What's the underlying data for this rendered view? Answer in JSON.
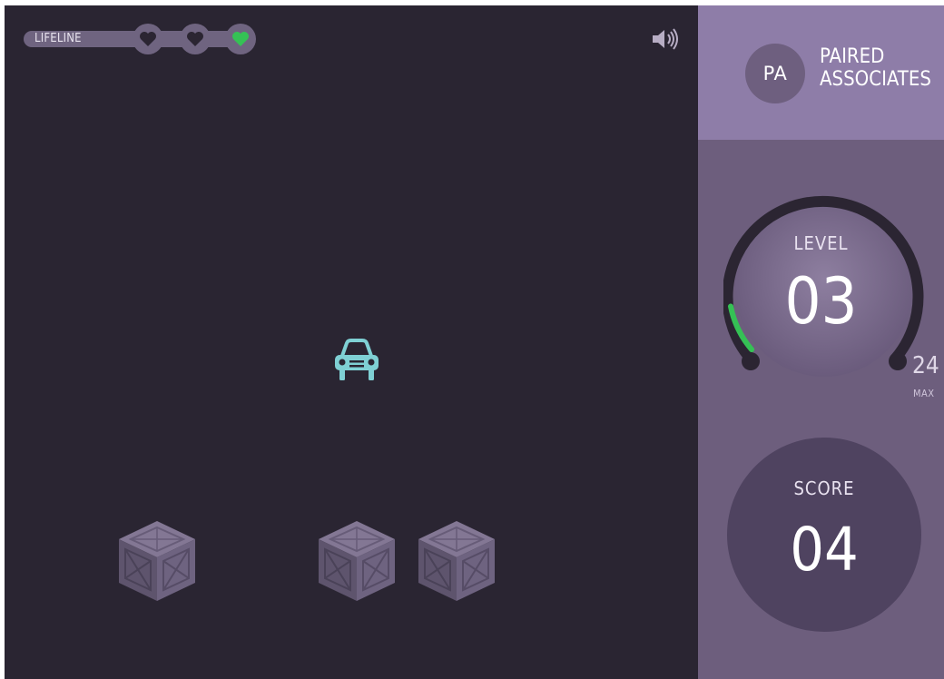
{
  "lifeline": {
    "label": "LIFELINE",
    "hearts_total": 3,
    "hearts_active": 1,
    "colors": {
      "empty": "#2b2532",
      "active": "#35c155"
    }
  },
  "sound": {
    "icon": "speaker-icon"
  },
  "stage": {
    "target_icon": "car-icon",
    "target_color": "#7fd0d4",
    "crate_count": 3,
    "crate_icon": "crate-icon"
  },
  "sidebar": {
    "avatar_initials": "PA",
    "title": "PAIRED\nASSOCIATES",
    "level": {
      "label": "LEVEL",
      "value": "03",
      "max_value": "24",
      "max_label": "MAX",
      "progress_color": "#35c155"
    },
    "score": {
      "label": "SCORE",
      "value": "04"
    }
  }
}
